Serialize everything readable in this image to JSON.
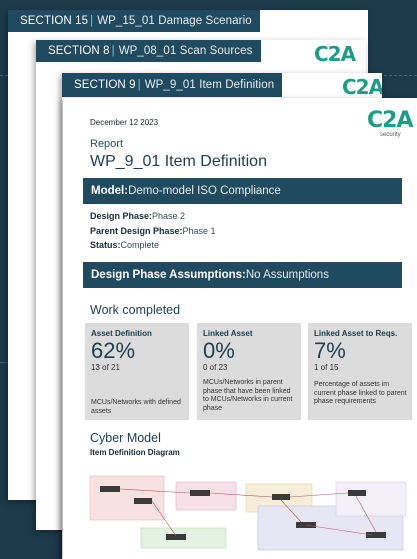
{
  "cards": [
    {
      "section": "SECTION 15",
      "work_package": "WP_15_01 Damage Scenario"
    },
    {
      "section": "SECTION 8",
      "work_package": "WP_08_01 Scan Sources"
    },
    {
      "section": "SECTION 9",
      "work_package": "WP_9_01 Item Definition"
    }
  ],
  "logo": {
    "text": "C2A",
    "tagline": "security"
  },
  "report": {
    "date": "December 12 2023",
    "doc_type": "Report",
    "title": "WP_9_01 Item Definition",
    "model_label": "Model:",
    "model_value": "Demo-model ISO Compliance",
    "design_phase_label": "Design Phase:",
    "design_phase_value": "Phase 2",
    "parent_phase_label": "Parent Design Phase:",
    "parent_phase_value": "Phase 1",
    "status_label": "Status:",
    "status_value": "Complete",
    "assumptions_label": "Design Phase Assumptions:",
    "assumptions_value": "No Assumptions",
    "work_completed_title": "Work completed",
    "metrics": [
      {
        "label": "Asset Definition",
        "value": "62%",
        "count": "13 of 21",
        "desc": "MCUs/Networks with defined assets"
      },
      {
        "label": "Linked Asset",
        "value": "0%",
        "count": "0 of 23",
        "desc": "MCUs/Networks in parent phase that have been linked to MCUs/Networks in current phase"
      },
      {
        "label": "Linked Asset to Reqs.",
        "value": "7%",
        "count": "1 of 15",
        "desc": "Percentage of assets im current phase linked to parent phase requirements"
      }
    ],
    "cyber_model_title": "Cyber Model",
    "diagram_title": "Item Definition Diagram"
  },
  "colors": {
    "navy": "#1f4a60",
    "accent": "#6fc6d8",
    "logo_green": "#1f9b86",
    "metric_bg": "#dcdcdc"
  },
  "icons": [
    "c2a-logo"
  ]
}
